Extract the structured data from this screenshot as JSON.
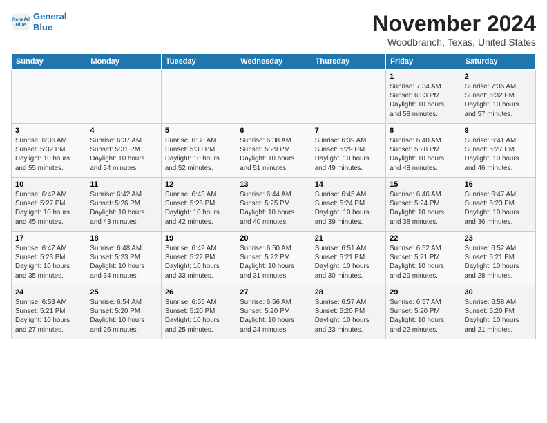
{
  "header": {
    "logo_line1": "General",
    "logo_line2": "Blue",
    "month": "November 2024",
    "location": "Woodbranch, Texas, United States"
  },
  "weekdays": [
    "Sunday",
    "Monday",
    "Tuesday",
    "Wednesday",
    "Thursday",
    "Friday",
    "Saturday"
  ],
  "weeks": [
    [
      {
        "day": "",
        "info": ""
      },
      {
        "day": "",
        "info": ""
      },
      {
        "day": "",
        "info": ""
      },
      {
        "day": "",
        "info": ""
      },
      {
        "day": "",
        "info": ""
      },
      {
        "day": "1",
        "info": "Sunrise: 7:34 AM\nSunset: 6:33 PM\nDaylight: 10 hours\nand 58 minutes."
      },
      {
        "day": "2",
        "info": "Sunrise: 7:35 AM\nSunset: 6:32 PM\nDaylight: 10 hours\nand 57 minutes."
      }
    ],
    [
      {
        "day": "3",
        "info": "Sunrise: 6:36 AM\nSunset: 5:32 PM\nDaylight: 10 hours\nand 55 minutes."
      },
      {
        "day": "4",
        "info": "Sunrise: 6:37 AM\nSunset: 5:31 PM\nDaylight: 10 hours\nand 54 minutes."
      },
      {
        "day": "5",
        "info": "Sunrise: 6:38 AM\nSunset: 5:30 PM\nDaylight: 10 hours\nand 52 minutes."
      },
      {
        "day": "6",
        "info": "Sunrise: 6:38 AM\nSunset: 5:29 PM\nDaylight: 10 hours\nand 51 minutes."
      },
      {
        "day": "7",
        "info": "Sunrise: 6:39 AM\nSunset: 5:29 PM\nDaylight: 10 hours\nand 49 minutes."
      },
      {
        "day": "8",
        "info": "Sunrise: 6:40 AM\nSunset: 5:28 PM\nDaylight: 10 hours\nand 48 minutes."
      },
      {
        "day": "9",
        "info": "Sunrise: 6:41 AM\nSunset: 5:27 PM\nDaylight: 10 hours\nand 46 minutes."
      }
    ],
    [
      {
        "day": "10",
        "info": "Sunrise: 6:42 AM\nSunset: 5:27 PM\nDaylight: 10 hours\nand 45 minutes."
      },
      {
        "day": "11",
        "info": "Sunrise: 6:42 AM\nSunset: 5:26 PM\nDaylight: 10 hours\nand 43 minutes."
      },
      {
        "day": "12",
        "info": "Sunrise: 6:43 AM\nSunset: 5:26 PM\nDaylight: 10 hours\nand 42 minutes."
      },
      {
        "day": "13",
        "info": "Sunrise: 6:44 AM\nSunset: 5:25 PM\nDaylight: 10 hours\nand 40 minutes."
      },
      {
        "day": "14",
        "info": "Sunrise: 6:45 AM\nSunset: 5:24 PM\nDaylight: 10 hours\nand 39 minutes."
      },
      {
        "day": "15",
        "info": "Sunrise: 6:46 AM\nSunset: 5:24 PM\nDaylight: 10 hours\nand 38 minutes."
      },
      {
        "day": "16",
        "info": "Sunrise: 6:47 AM\nSunset: 5:23 PM\nDaylight: 10 hours\nand 36 minutes."
      }
    ],
    [
      {
        "day": "17",
        "info": "Sunrise: 6:47 AM\nSunset: 5:23 PM\nDaylight: 10 hours\nand 35 minutes."
      },
      {
        "day": "18",
        "info": "Sunrise: 6:48 AM\nSunset: 5:23 PM\nDaylight: 10 hours\nand 34 minutes."
      },
      {
        "day": "19",
        "info": "Sunrise: 6:49 AM\nSunset: 5:22 PM\nDaylight: 10 hours\nand 33 minutes."
      },
      {
        "day": "20",
        "info": "Sunrise: 6:50 AM\nSunset: 5:22 PM\nDaylight: 10 hours\nand 31 minutes."
      },
      {
        "day": "21",
        "info": "Sunrise: 6:51 AM\nSunset: 5:21 PM\nDaylight: 10 hours\nand 30 minutes."
      },
      {
        "day": "22",
        "info": "Sunrise: 6:52 AM\nSunset: 5:21 PM\nDaylight: 10 hours\nand 29 minutes."
      },
      {
        "day": "23",
        "info": "Sunrise: 6:52 AM\nSunset: 5:21 PM\nDaylight: 10 hours\nand 28 minutes."
      }
    ],
    [
      {
        "day": "24",
        "info": "Sunrise: 6:53 AM\nSunset: 5:21 PM\nDaylight: 10 hours\nand 27 minutes."
      },
      {
        "day": "25",
        "info": "Sunrise: 6:54 AM\nSunset: 5:20 PM\nDaylight: 10 hours\nand 26 minutes."
      },
      {
        "day": "26",
        "info": "Sunrise: 6:55 AM\nSunset: 5:20 PM\nDaylight: 10 hours\nand 25 minutes."
      },
      {
        "day": "27",
        "info": "Sunrise: 6:56 AM\nSunset: 5:20 PM\nDaylight: 10 hours\nand 24 minutes."
      },
      {
        "day": "28",
        "info": "Sunrise: 6:57 AM\nSunset: 5:20 PM\nDaylight: 10 hours\nand 23 minutes."
      },
      {
        "day": "29",
        "info": "Sunrise: 6:57 AM\nSunset: 5:20 PM\nDaylight: 10 hours\nand 22 minutes."
      },
      {
        "day": "30",
        "info": "Sunrise: 6:58 AM\nSunset: 5:20 PM\nDaylight: 10 hours\nand 21 minutes."
      }
    ]
  ]
}
